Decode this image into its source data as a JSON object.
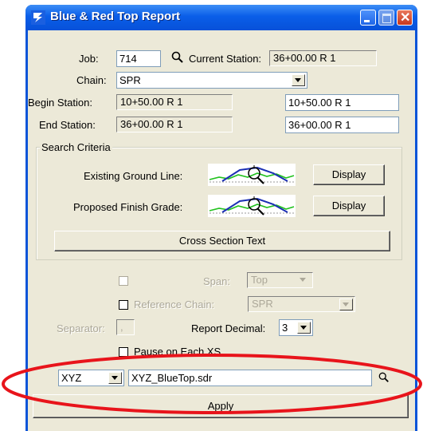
{
  "window": {
    "title": "Blue & Red Top Report"
  },
  "job": {
    "label": "Job:",
    "value": "714"
  },
  "current_station": {
    "label": "Current Station:",
    "value": "36+00.00 R 1"
  },
  "chain": {
    "label": "Chain:",
    "value": "SPR"
  },
  "begin_station": {
    "label": "Begin Station:",
    "value": "10+50.00 R 1",
    "edit_value": "10+50.00 R 1"
  },
  "end_station": {
    "label": "End Station:",
    "value": "36+00.00 R 1",
    "edit_value": "36+00.00 R 1"
  },
  "search_criteria": {
    "label": "Search Criteria",
    "existing_ground_label": "Existing Ground Line:",
    "proposed_finish_label": "Proposed Finish Grade:",
    "display_label": "Display",
    "cross_section_text_label": "Cross Section Text"
  },
  "span": {
    "label": "Span:",
    "value": "Top"
  },
  "reference_chain": {
    "label": "Reference Chain:",
    "value": "SPR"
  },
  "separator": {
    "label": "Separator:",
    "value": ","
  },
  "report_decimal": {
    "label": "Report Decimal:",
    "value": "3"
  },
  "pause_each_xs": {
    "label": "Pause on Each XS"
  },
  "output": {
    "format": "XYZ",
    "file": "XYZ_BlueTop.sdr"
  },
  "apply": {
    "label": "Apply"
  },
  "colors": {
    "highlight_ellipse": "#e8141b",
    "titlebar": "#0a5ee8"
  }
}
